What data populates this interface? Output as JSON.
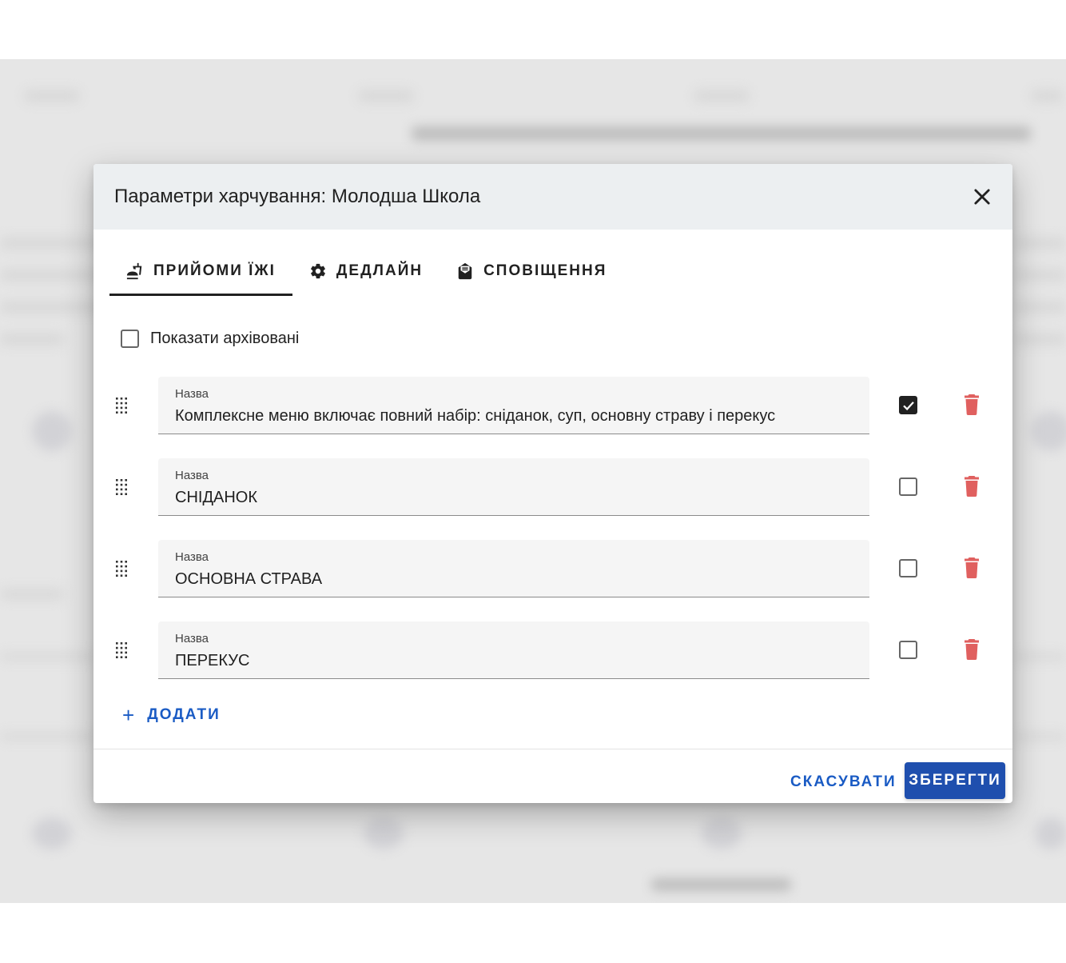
{
  "dialog": {
    "title": "Параметри харчування: Молодша Школа"
  },
  "tabs": [
    {
      "label": "ПРИЙОМИ ЇЖІ",
      "icon": "food-icon",
      "active": true
    },
    {
      "label": "ДЕДЛАЙН",
      "icon": "gear-icon",
      "active": false
    },
    {
      "label": "СПОВІЩЕННЯ",
      "icon": "mail-icon",
      "active": false
    }
  ],
  "show_archived": {
    "label": "Показати архівовані",
    "checked": false
  },
  "meals": [
    {
      "field_label": "Назва",
      "value": "Комплексне меню включає повний набір: сніданок, суп, основну страву і перекус",
      "checked": true
    },
    {
      "field_label": "Назва",
      "value": "СНІДАНОК",
      "checked": false
    },
    {
      "field_label": "Назва",
      "value": "ОСНОВНА СТРАВА",
      "checked": false
    },
    {
      "field_label": "Назва",
      "value": "ПЕРЕКУС",
      "checked": false
    }
  ],
  "add_button": {
    "label": "ДОДАТИ"
  },
  "footer": {
    "cancel_label": "СКАСУВАТИ",
    "save_label": "ЗБЕРЕГТИ"
  },
  "colors": {
    "accent": "#1a5bc4",
    "save_bg": "#1f4fae",
    "trash": "#e0605f",
    "header_bg": "#eceff1"
  }
}
